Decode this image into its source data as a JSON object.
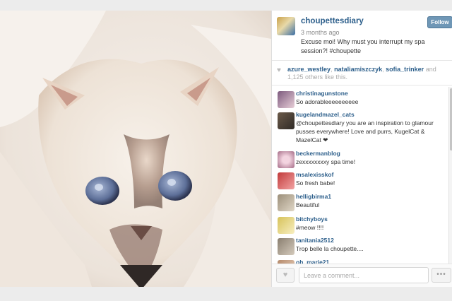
{
  "post": {
    "username": "choupettesdiary",
    "time": "3 months ago",
    "caption": "Excuse moi! Why must you interrupt my spa session?! #choupette",
    "follow_label": "Follow"
  },
  "likes": {
    "heart_icon": "heart-icon",
    "users": [
      "azure_westley",
      "nataliamiszczyk",
      "sofia_trinker"
    ],
    "separator_1": ",",
    "separator_2": ",",
    "suffix": " and 1,125 others like this."
  },
  "comments": [
    {
      "user": "christinagunstone",
      "text": "So adorableeeeeeeeee ",
      "avatar_color": "#7d5a7e"
    },
    {
      "user": "kugelandmazel_cats",
      "text": "@choupettesdiary you are an inspiration to glamour pusses everywhere! Love and purrs, KugelCat & MazelCat ❤",
      "avatar_color": "#6b5a49"
    },
    {
      "user": "beckermanblog",
      "text": "zexxxxxxxxy spa time!",
      "avatar_color": "#a46b86"
    },
    {
      "user": "msalexisskof",
      "text": "So fresh babe! ",
      "avatar_color": "#c23b3b"
    },
    {
      "user": "helligbirma1",
      "text": " Beautiful ",
      "avatar_color": "#9c8f7a"
    },
    {
      "user": "bitchyboys",
      "text": "#meow !!!!",
      "avatar_color": "#d6c25a"
    },
    {
      "user": "tanitania2512",
      "text": "Trop belle la choupette....",
      "avatar_color": "#8a7f70"
    },
    {
      "user": "oh_marie21",
      "text": "",
      "avatar_color": "#b58a6b"
    }
  ],
  "footer": {
    "comment_placeholder": "Leave a comment...",
    "more_label": "•••"
  },
  "colors": {
    "username": "#2d5f8b",
    "follow_button": "#6f97b6"
  }
}
